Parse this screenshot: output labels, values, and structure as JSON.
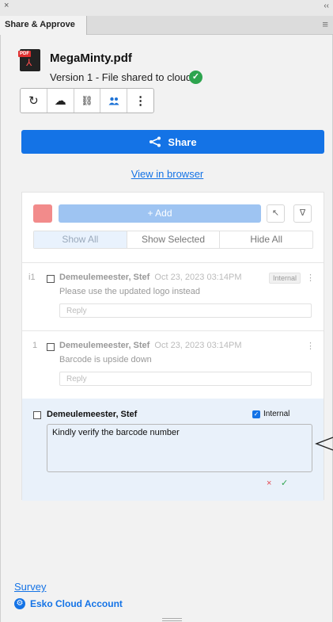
{
  "window": {
    "close_glyph": "×",
    "collapse_glyph": "‹‹"
  },
  "tab": {
    "title": "Share & Approve",
    "menu_glyph": "≡"
  },
  "file": {
    "name": "MegaMinty.pdf",
    "badge": "PDF",
    "version_text": "Version 1 - File shared to cloud",
    "status_icon": "check-circle-icon",
    "status_color": "#2da44e"
  },
  "toolbar": {
    "buttons": [
      {
        "icon": "refresh-icon",
        "glyph": "↻"
      },
      {
        "icon": "cloud-upload-icon",
        "glyph": "☁"
      },
      {
        "icon": "unlink-icon",
        "glyph": "⛓"
      },
      {
        "icon": "people-icon",
        "glyph": "👥"
      },
      {
        "icon": "more-icon",
        "glyph": "⋮"
      }
    ]
  },
  "share": {
    "label": "Share",
    "color": "#1473e6"
  },
  "view_link": "View in browser",
  "comments": {
    "add_label": "+ Add",
    "swatch_color": "#f28b8b",
    "filters": [
      "Show All",
      "Show Selected",
      "Hide All"
    ],
    "items": [
      {
        "number": "i1",
        "author": "Demeulemeester, Stef",
        "date": "Oct 23, 2023 03:14PM",
        "tag": "Internal",
        "text": "Please use the updated logo instead",
        "reply_placeholder": "Reply"
      },
      {
        "number": "1",
        "author": "Demeulemeester, Stef",
        "date": "Oct 23, 2023 03:14PM",
        "text": "Barcode is upside down",
        "reply_placeholder": "Reply"
      }
    ],
    "new_comment": {
      "author": "Demeulemeester, Stef",
      "internal_label": "Internal",
      "internal_checked": true,
      "text": "Kindly verify the barcode number",
      "cancel_glyph": "×",
      "confirm_glyph": "✓"
    }
  },
  "footer": {
    "survey": "Survey",
    "account": "Esko Cloud Account"
  }
}
